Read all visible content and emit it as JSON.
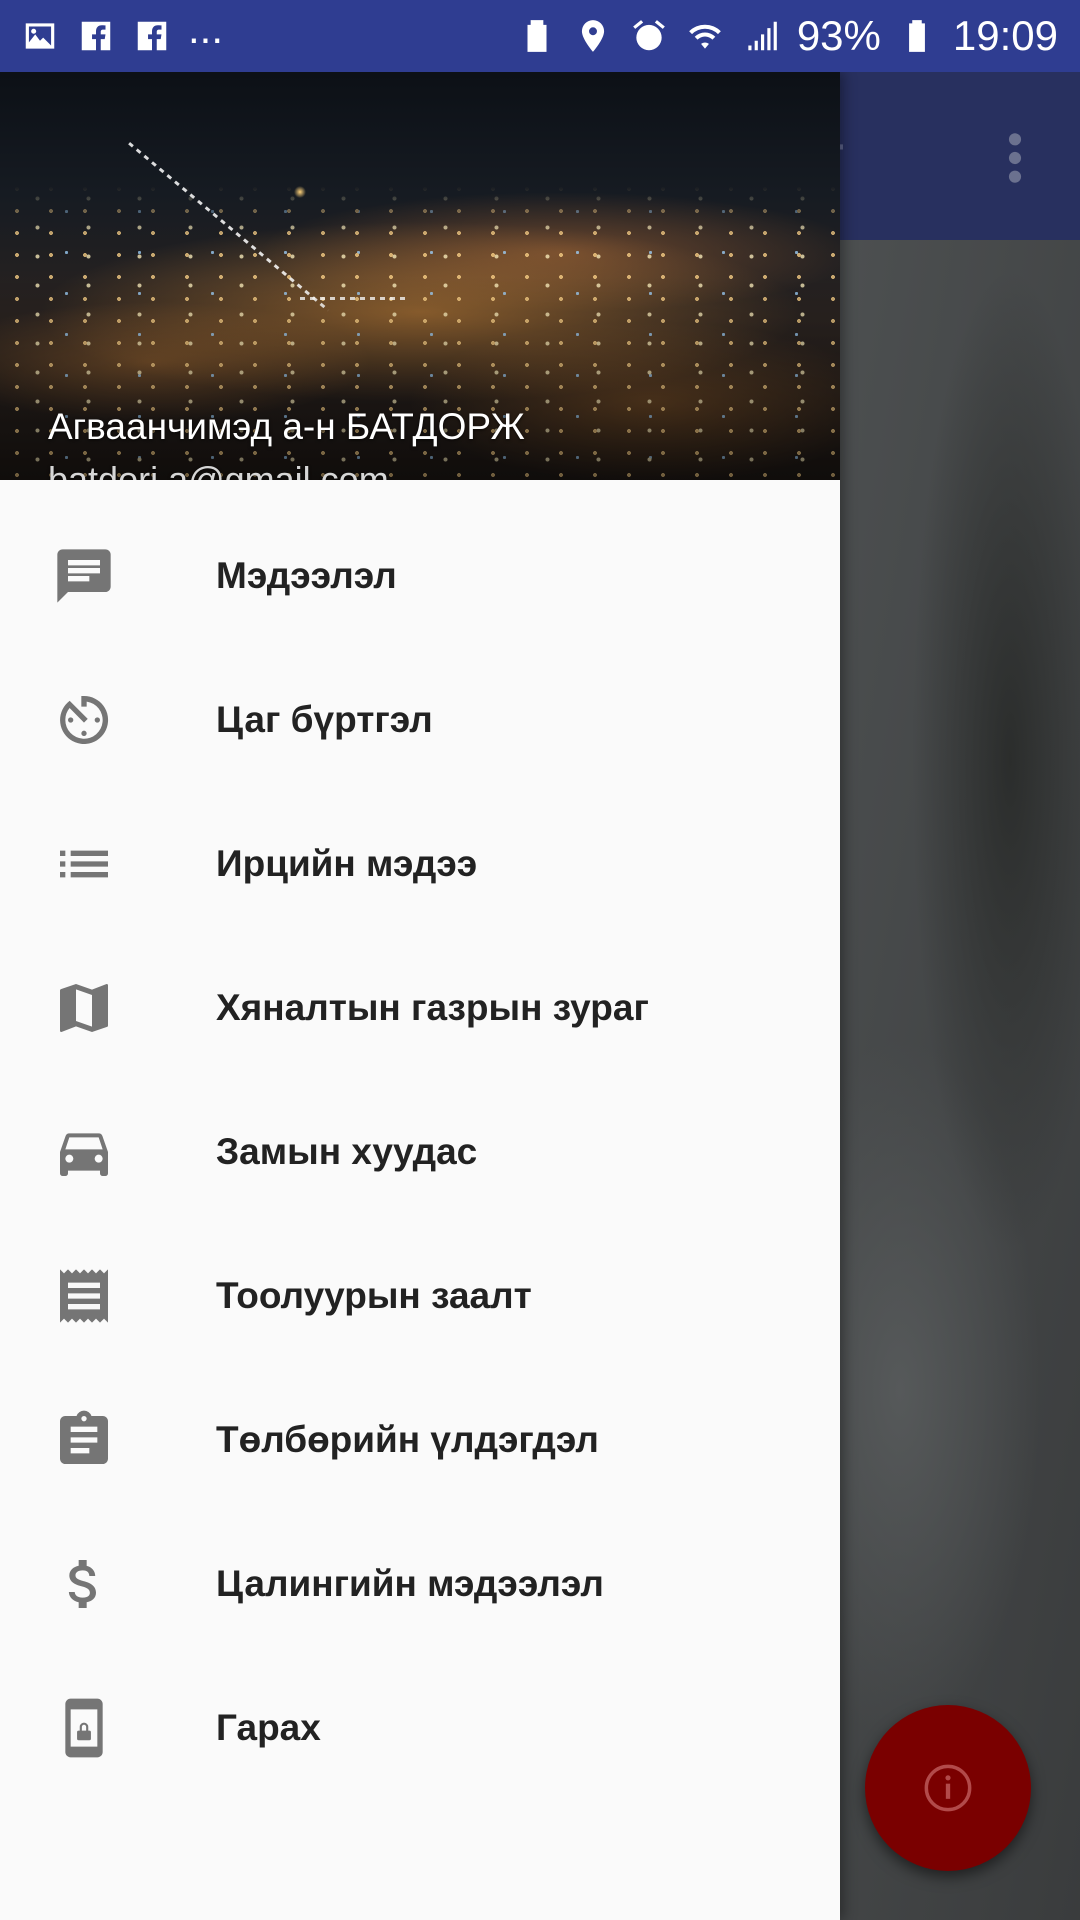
{
  "status_bar": {
    "left_icons": [
      "gallery-icon",
      "facebook-icon",
      "facebook-icon"
    ],
    "more_indicator": "...",
    "right_icons": [
      "recycle-icon",
      "location-icon",
      "alarm-icon",
      "wifi-icon",
      "signal-icon",
      "battery-icon"
    ],
    "battery": "93%",
    "time": "19:09"
  },
  "background_app": {
    "title_fragment": "аг",
    "overflow_icon": "more-vert-icon",
    "fab_icon": "info-icon",
    "colors": {
      "toolbar": "#28305f",
      "fab": "#7a0000"
    }
  },
  "drawer": {
    "header": {
      "name": "Агваанчимэд а-н БАТДОРЖ",
      "email": "batdorj.a@gmail.com"
    },
    "items": [
      {
        "label": "Мэдээлэл",
        "icon": "message-icon"
      },
      {
        "label": "Цаг бүртгэл",
        "icon": "timer-icon"
      },
      {
        "label": "Ирцийн мэдээ",
        "icon": "list-icon"
      },
      {
        "label": "Хяналтын газрын зураг",
        "icon": "map-icon"
      },
      {
        "label": "Замын хуудас",
        "icon": "car-icon"
      },
      {
        "label": "Тоолуурын заалт",
        "icon": "receipt-icon"
      },
      {
        "label": "Төлбөрийн үлдэгдэл",
        "icon": "clipboard-icon"
      },
      {
        "label": "Цалингийн мэдээлэл",
        "icon": "dollar-icon"
      },
      {
        "label": "Гарах",
        "icon": "phone-lock-icon"
      }
    ]
  },
  "colors": {
    "status_bar": "#2f3d91",
    "drawer_bg": "#fafafa",
    "icon": "#757575",
    "text": "#222222"
  }
}
